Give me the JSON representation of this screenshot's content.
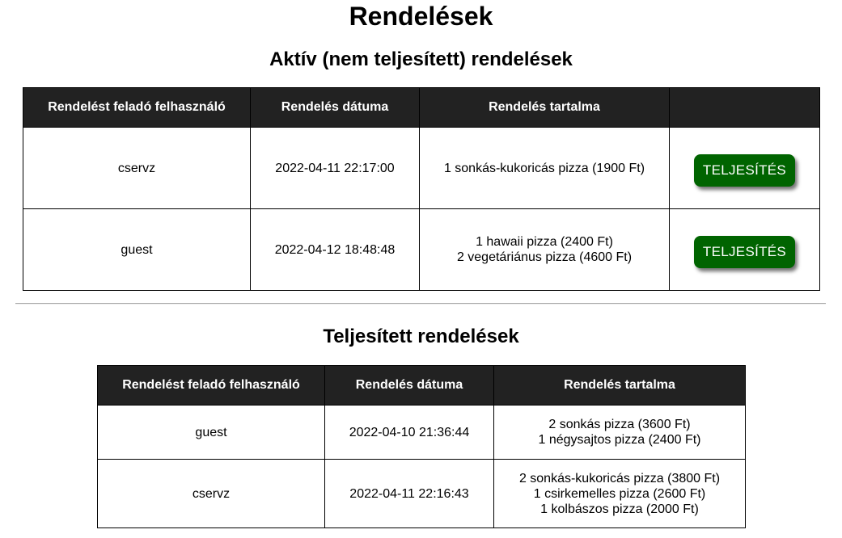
{
  "page": {
    "title": "Rendelések"
  },
  "active": {
    "title": "Aktív (nem teljesített) rendelések",
    "headers": [
      "Rendelést feladó felhasználó",
      "Rendelés dátuma",
      "Rendelés tartalma",
      ""
    ],
    "rows": [
      {
        "user": "cservz",
        "date": "2022-04-11 22:17:00",
        "items": [
          "1 sonkás-kukoricás pizza (1900 Ft)"
        ],
        "button_label": "TELJESÍTÉS"
      },
      {
        "user": "guest",
        "date": "2022-04-12 18:48:48",
        "items": [
          "1 hawaii pizza (2400 Ft)",
          "2 vegetáriánus pizza (4600 Ft)"
        ],
        "button_label": "TELJESÍTÉS"
      }
    ]
  },
  "completed": {
    "title": "Teljesített rendelések",
    "headers": [
      "Rendelést feladó felhasználó",
      "Rendelés dátuma",
      "Rendelés tartalma"
    ],
    "rows": [
      {
        "user": "guest",
        "date": "2022-04-10 21:36:44",
        "items": [
          "2 sonkás pizza (3600 Ft)",
          "1 négysajtos pizza (2400 Ft)"
        ]
      },
      {
        "user": "cservz",
        "date": "2022-04-11 22:16:43",
        "items": [
          "2 sonkás-kukoricás pizza (3800 Ft)",
          "1 csirkemelles pizza (2600 Ft)",
          "1 kolbászos pizza (2000 Ft)"
        ]
      }
    ]
  },
  "colors": {
    "button_bg": "#006400",
    "header_bg": "#222222"
  }
}
